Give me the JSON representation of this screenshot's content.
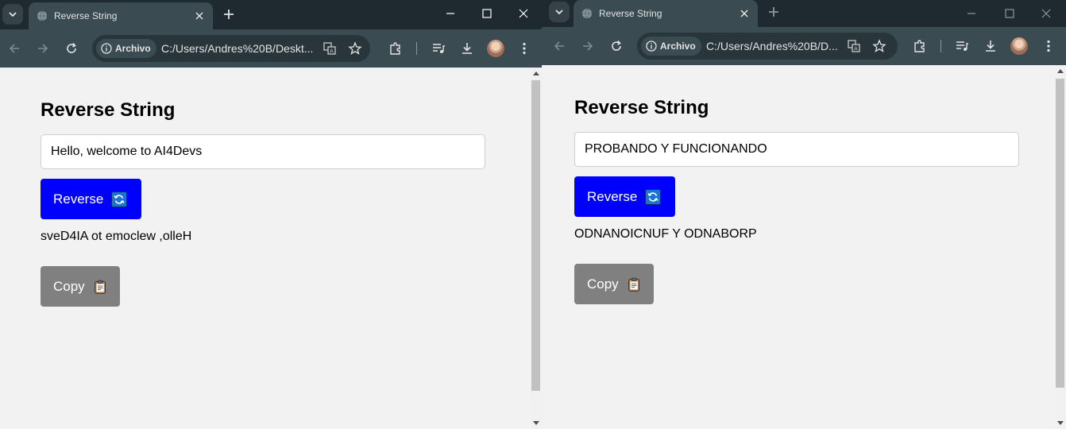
{
  "windows": [
    {
      "id": "left",
      "tab": {
        "title": "Reverse String"
      },
      "omnibox": {
        "chip_label": "Archivo",
        "url": "C:/Users/Andres%20B/Deskt..."
      },
      "page": {
        "heading": "Reverse String",
        "input_value": "Hello, welcome to AI4Devs",
        "reverse_label": "Reverse",
        "result": "sveD4IA ot emoclew ,olleH",
        "copy_label": "Copy"
      }
    },
    {
      "id": "right",
      "tab": {
        "title": "Reverse String"
      },
      "omnibox": {
        "chip_label": "Archivo",
        "url": "C:/Users/Andres%20B/D..."
      },
      "page": {
        "heading": "Reverse String",
        "input_value": "PROBANDO Y FUNCIONANDO",
        "reverse_label": "Reverse",
        "result": "ODNANOICNUF Y ODNABORP",
        "copy_label": "Copy"
      }
    }
  ],
  "icons": {
    "reverse_button_icon": "refresh-icon",
    "copy_button_icon": "clipboard-icon"
  },
  "colors": {
    "reverse_button": "#0000ff",
    "copy_button": "#808080",
    "toolbar": "#3a4b52",
    "tabbar": "#1f2a30",
    "page_background": "#f2f2f2"
  }
}
